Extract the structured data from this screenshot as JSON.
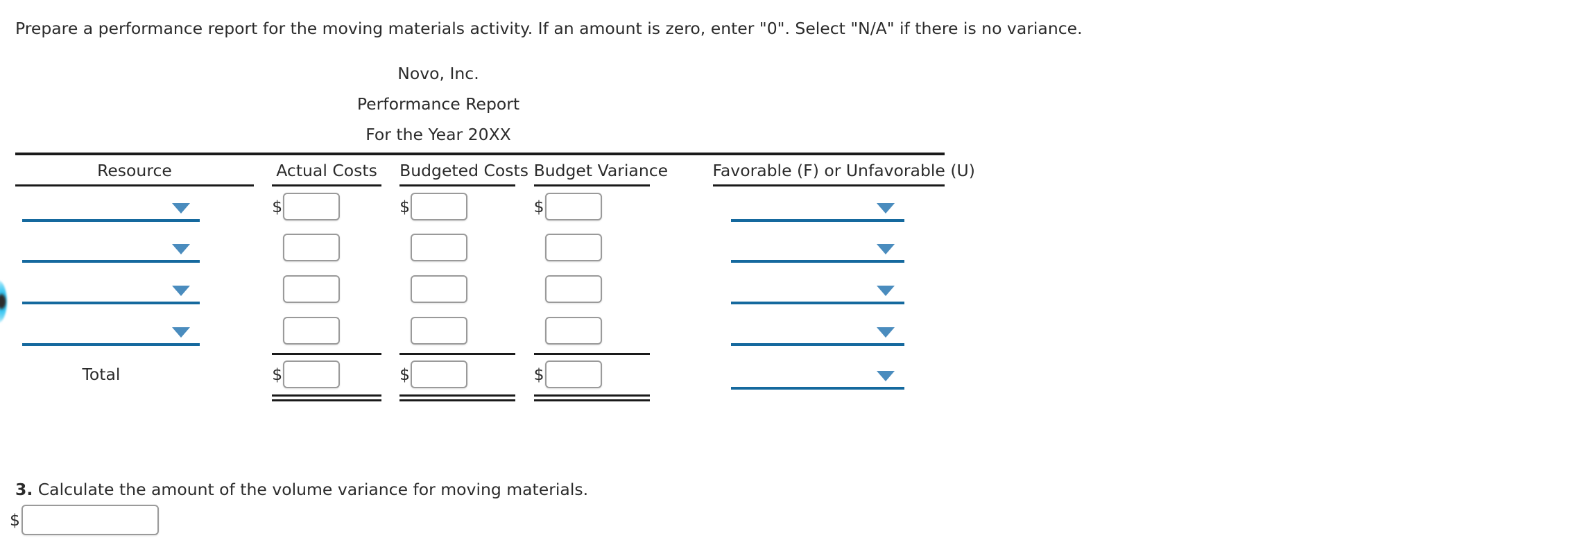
{
  "prompt": "Prepare a performance report for the moving materials activity. If an amount is zero, enter \"0\". Select \"N/A\" if there is no variance.",
  "report": {
    "company": "Novo, Inc.",
    "title": "Performance Report",
    "period": "For the Year 20XX",
    "columns": [
      "Resource",
      "Actual Costs",
      "Budgeted Costs",
      "Budget Variance",
      "Favorable (F) or Unfavorable (U)"
    ],
    "rows": [
      {
        "resource_select": "",
        "actual_currency": "$",
        "actual_value": "",
        "budgeted_currency": "$",
        "budgeted_value": "",
        "variance_currency": "$",
        "variance_value": "",
        "favorable_select": ""
      },
      {
        "resource_select": "",
        "actual_currency": "",
        "actual_value": "",
        "budgeted_currency": "",
        "budgeted_value": "",
        "variance_currency": "",
        "variance_value": "",
        "favorable_select": ""
      },
      {
        "resource_select": "",
        "actual_currency": "",
        "actual_value": "",
        "budgeted_currency": "",
        "budgeted_value": "",
        "variance_currency": "",
        "variance_value": "",
        "favorable_select": ""
      },
      {
        "resource_select": "",
        "actual_currency": "",
        "actual_value": "",
        "budgeted_currency": "",
        "budgeted_value": "",
        "variance_currency": "",
        "variance_value": "",
        "favorable_select": ""
      }
    ],
    "total": {
      "label": "Total",
      "actual_currency": "$",
      "actual_value": "",
      "budgeted_currency": "$",
      "budgeted_value": "",
      "variance_currency": "$",
      "variance_value": "",
      "favorable_select": ""
    }
  },
  "question3": {
    "number": "3.",
    "text": "Calculate the amount of the volume variance for moving materials.",
    "currency": "$",
    "value": ""
  },
  "colors": {
    "select_underline": "#15699e",
    "select_arrow": "#4a8cbe",
    "rule": "#1a1a1a",
    "input_border": "#9a9a9a",
    "text": "#2b2b2b"
  }
}
